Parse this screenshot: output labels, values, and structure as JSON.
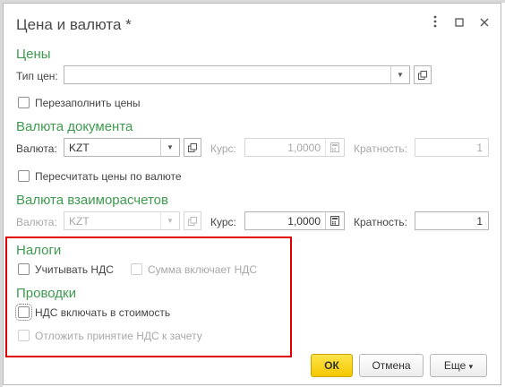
{
  "window": {
    "title": "Цена и валюта *",
    "menu_icon": "vertical-dots-icon",
    "maximize_icon": "maximize-icon",
    "close_icon": "close-icon"
  },
  "prices": {
    "section_title": "Цены",
    "price_type_label": "Тип цен:",
    "price_type_value": "",
    "refill_prices_label": "Перезаполнить цены"
  },
  "doc_currency": {
    "section_title": "Валюта документа",
    "currency_label": "Валюта:",
    "currency_value": "KZT",
    "rate_label": "Курс:",
    "rate_value": "1,0000",
    "multiplicity_label": "Кратность:",
    "multiplicity_value": "1",
    "recalc_label": "Пересчитать цены по валюте"
  },
  "settlement_currency": {
    "section_title": "Валюта взаиморасчетов",
    "currency_label": "Валюта:",
    "currency_value": "KZT",
    "rate_label": "Курс:",
    "rate_value": "1,0000",
    "multiplicity_label": "Кратность:",
    "multiplicity_value": "1"
  },
  "taxes": {
    "section_title": "Налоги",
    "account_vat_label": "Учитывать НДС",
    "amount_includes_vat_label": "Сумма включает НДС"
  },
  "postings": {
    "section_title": "Проводки",
    "vat_in_cost_label": "НДС включать в стоимость",
    "defer_vat_label": "Отложить принятие НДС к зачету"
  },
  "buttons": {
    "ok": "ОК",
    "cancel": "Отмена",
    "more": "Еще",
    "more_arrow": "▾"
  },
  "colors": {
    "section_green": "#3e9a4e",
    "ok_yellow": "#f4c800",
    "highlight_red": "#e00000"
  }
}
